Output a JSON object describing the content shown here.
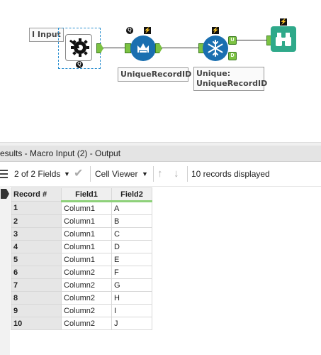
{
  "workflow": {
    "input_label": "I Input",
    "unique_label": "UniqueRecordID",
    "unique_output_label": "Unique:\nUniqueRecordID",
    "badge_q": "Q",
    "badge_u": "U",
    "badge_d": "D"
  },
  "results": {
    "title": "esults - Macro Input (2) - Output",
    "fields_dropdown": "2 of 2 Fields",
    "viewer_dropdown": "Cell Viewer",
    "status": "10 records displayed",
    "columns": [
      "Record #",
      "Field1",
      "Field2"
    ],
    "rows": [
      [
        "1",
        "Column1",
        "A"
      ],
      [
        "2",
        "Column1",
        "B"
      ],
      [
        "3",
        "Column1",
        "C"
      ],
      [
        "4",
        "Column1",
        "D"
      ],
      [
        "5",
        "Column1",
        "E"
      ],
      [
        "6",
        "Column2",
        "F"
      ],
      [
        "7",
        "Column2",
        "G"
      ],
      [
        "8",
        "Column2",
        "H"
      ],
      [
        "9",
        "Column2",
        "I"
      ],
      [
        "10",
        "Column2",
        "J"
      ]
    ]
  },
  "colors": {
    "anchor_green": "#7cc242",
    "tool_blue": "#1a6fb0",
    "browse_green": "#2fa98a",
    "field_underline": "#8ed17a"
  }
}
